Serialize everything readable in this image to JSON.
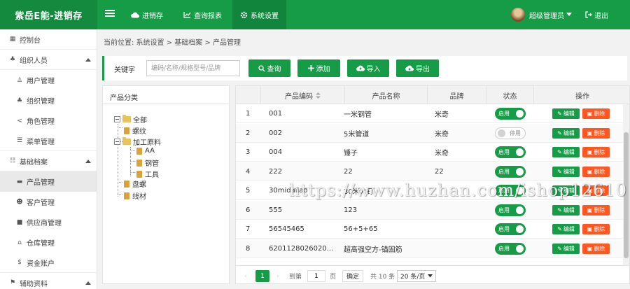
{
  "app": {
    "title": "紫岳E能-进销存"
  },
  "topnav": [
    {
      "label": "进销存",
      "icon": "cloud-icon"
    },
    {
      "label": "查询报表",
      "icon": "chart-icon"
    },
    {
      "label": "系统设置",
      "icon": "gear-icon",
      "active": true
    }
  ],
  "user": {
    "name": "超级管理员",
    "logout": "退出"
  },
  "sidebar": {
    "items": [
      {
        "label": "控制台",
        "icon": "dashboard-icon",
        "level": 1
      },
      {
        "label": "组织人员",
        "icon": "org-icon",
        "level": 1,
        "expanded": true
      },
      {
        "label": "用户管理",
        "icon": "user-icon",
        "level": 2
      },
      {
        "label": "组织管理",
        "icon": "sitemap-icon",
        "level": 2
      },
      {
        "label": "角色管理",
        "icon": "share-icon",
        "level": 2
      },
      {
        "label": "菜单管理",
        "icon": "list-icon",
        "level": 2
      },
      {
        "label": "基础档案",
        "icon": "list-icon",
        "level": 1,
        "expanded": true
      },
      {
        "label": "产品管理",
        "icon": "box-icon",
        "level": 2,
        "active": true
      },
      {
        "label": "客户管理",
        "icon": "users-icon",
        "level": 2
      },
      {
        "label": "供应商管理",
        "icon": "truck-icon",
        "level": 2
      },
      {
        "label": "仓库管理",
        "icon": "home-icon",
        "level": 2
      },
      {
        "label": "资金账户",
        "icon": "money-icon",
        "level": 2
      },
      {
        "label": "辅助资料",
        "icon": "tag-icon",
        "level": 1
      }
    ]
  },
  "breadcrumb": {
    "text": "当前位置:  系统设置  >  基础档案  >  产品管理"
  },
  "filter": {
    "keyword_label": "关键字",
    "placeholder": "编码/名称/规格型号/品牌",
    "search": "查询",
    "add": "添加",
    "import": "导入",
    "export": "导出"
  },
  "tree": {
    "title": "产品分类",
    "nodes": [
      "全部",
      "螺纹",
      "加工原料",
      "AA",
      "钢管",
      "工具",
      "盘螺",
      "线材"
    ]
  },
  "table": {
    "columns": [
      "产品编码",
      "产品名称",
      "品牌",
      "状态",
      "操作"
    ],
    "rows": [
      {
        "no": "1",
        "code": "001",
        "name": "一米钢管",
        "brand": "米奇",
        "status": "启用",
        "on": true
      },
      {
        "no": "2",
        "code": "002",
        "name": "5米管道",
        "brand": "米奇",
        "status": "停用",
        "on": false
      },
      {
        "no": "3",
        "code": "004",
        "name": "锤子",
        "brand": "米奇",
        "status": "启用",
        "on": true
      },
      {
        "no": "4",
        "code": "222",
        "name": "22",
        "brand": "22",
        "status": "启用",
        "on": true
      },
      {
        "no": "5",
        "code": "30midallao",
        "name": "30米大钉",
        "brand": "",
        "status": "启用",
        "on": true
      },
      {
        "no": "6",
        "code": "555",
        "name": "123",
        "brand": "",
        "status": "启用",
        "on": true
      },
      {
        "no": "7",
        "code": "56545465",
        "name": "56+5+65",
        "brand": "",
        "status": "启用",
        "on": true
      },
      {
        "no": "8",
        "code": "6201128026020...",
        "name": "超高强空方-锚固筋",
        "brand": "",
        "status": "启用",
        "on": true
      }
    ],
    "edit_label": "编辑",
    "delete_label": "删除"
  },
  "pager": {
    "current": "1",
    "goto_label": "到第",
    "goto_value": "1",
    "page_unit": "页",
    "confirm": "确定",
    "total": "共 10 条",
    "per_page": "20 条/页"
  },
  "watermark": {
    "text": "https://www.huzhan.com/ishop12610"
  }
}
